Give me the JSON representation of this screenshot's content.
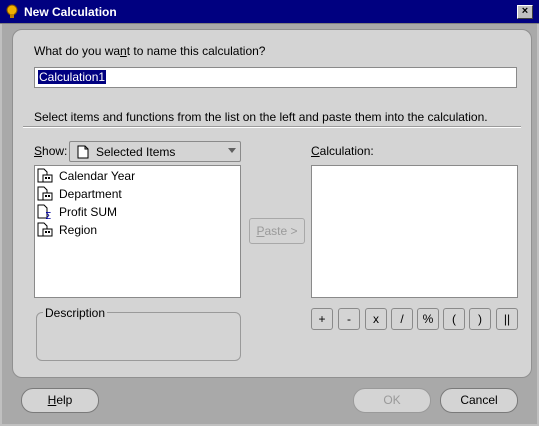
{
  "window": {
    "title": "New Calculation",
    "close_label": "×"
  },
  "name_section": {
    "prompt_pre": "What do you wa",
    "prompt_mnemonic": "n",
    "prompt_post": "t to name this calculation?",
    "value": "Calculation1"
  },
  "instructions": "Select items and functions from the list on the left and paste them into the calculation.",
  "show": {
    "label_mnemonic": "S",
    "label_rest": "how:",
    "selected": "Selected Items"
  },
  "items": [
    {
      "label": "Calendar Year",
      "icon": "dimension-folder-icon"
    },
    {
      "label": "Department",
      "icon": "dimension-folder-icon"
    },
    {
      "label": "Profit SUM",
      "icon": "sum-measure-icon"
    },
    {
      "label": "Region",
      "icon": "dimension-folder-icon"
    }
  ],
  "paste": {
    "mnemonic": "P",
    "rest": "aste",
    "arrow": ">"
  },
  "calculation": {
    "label_mnemonic": "C",
    "label_rest": "alculation:"
  },
  "operators": [
    "+",
    "-",
    "x",
    "/",
    "%",
    "(",
    ")",
    "||"
  ],
  "description_label": "Description",
  "buttons": {
    "help_mnemonic": "H",
    "help_rest": "elp",
    "ok": "OK",
    "cancel": "Cancel"
  },
  "colors": {
    "title_bar": "#000080",
    "selection": "#000080",
    "dialog_bg": "#d4d4d4",
    "frame_bg": "#a9a9a9"
  }
}
